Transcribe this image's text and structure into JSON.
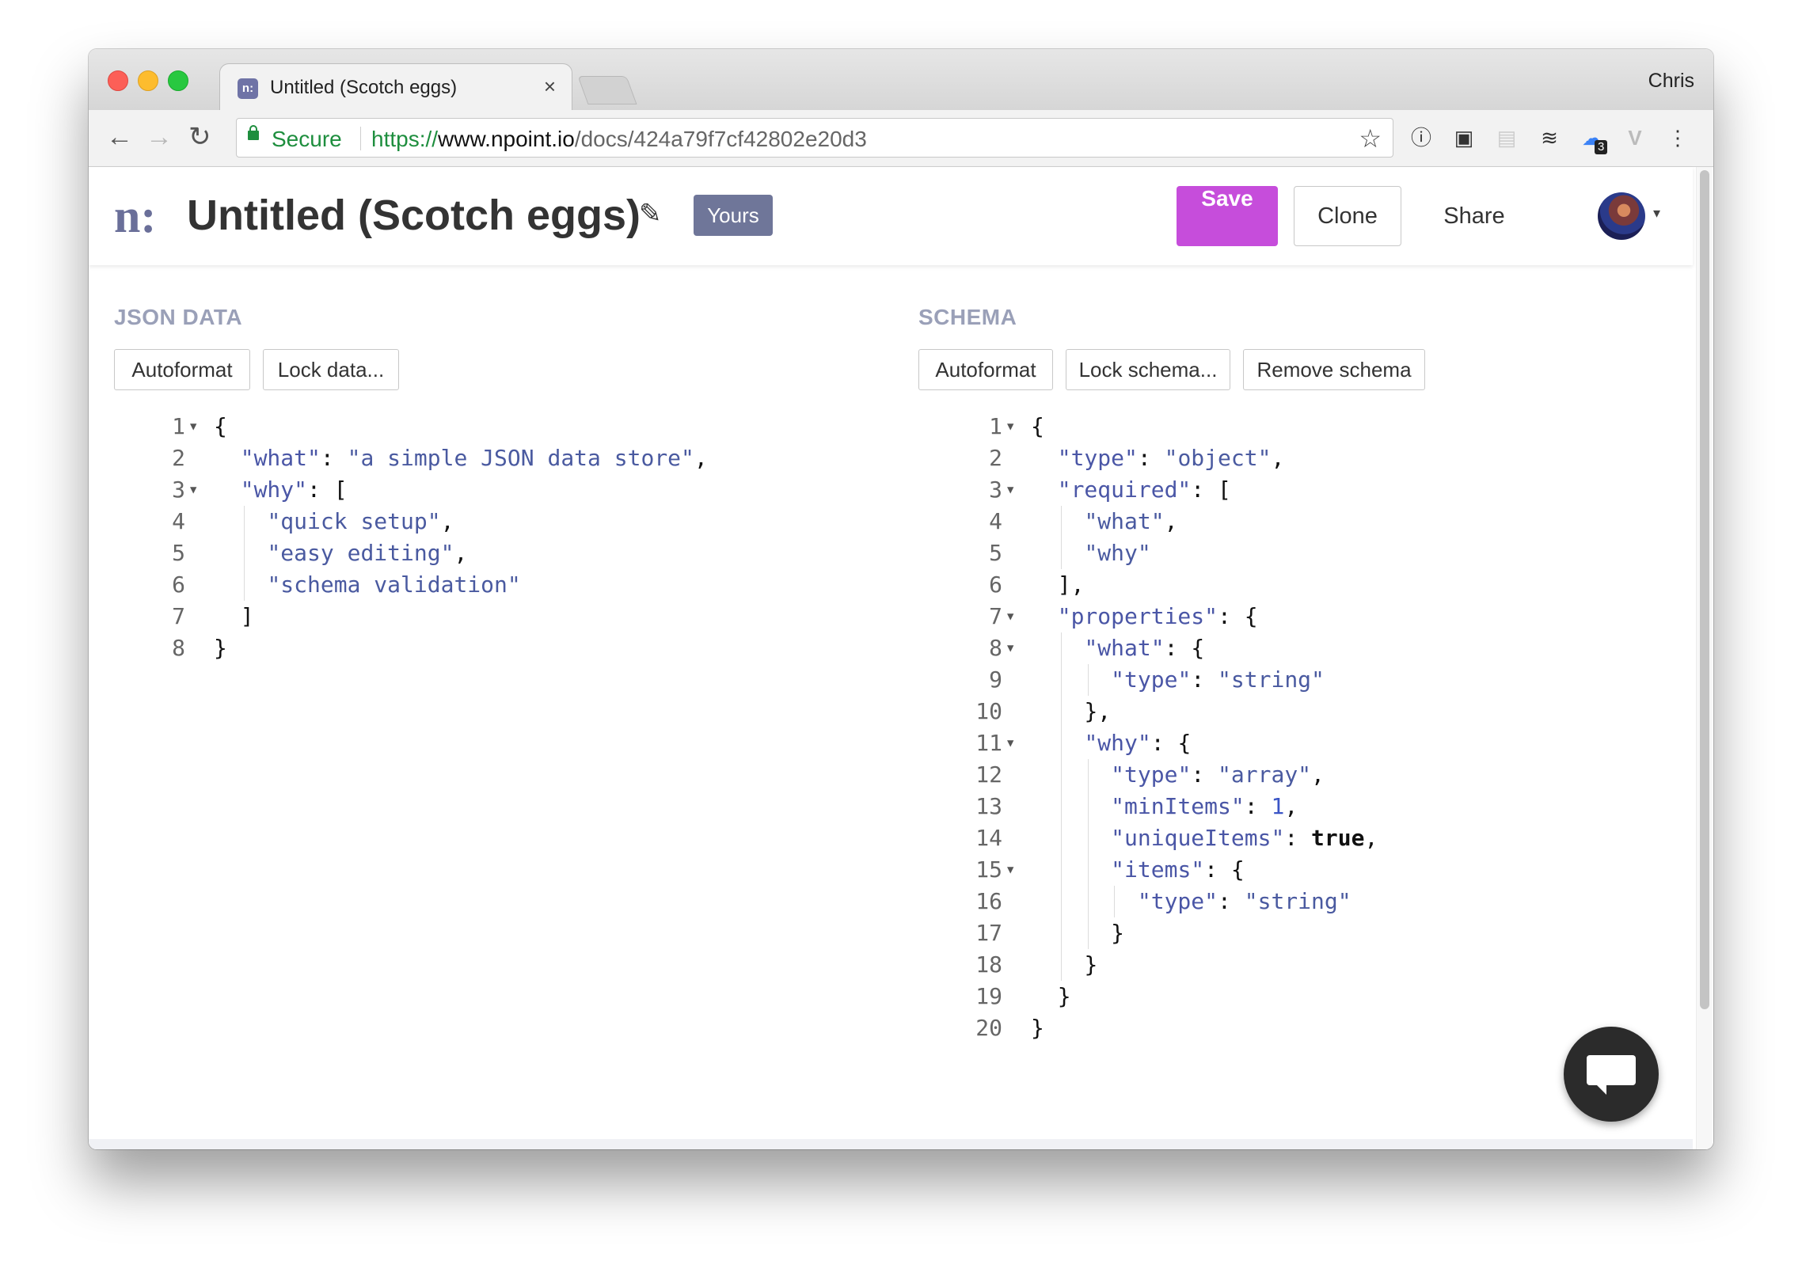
{
  "browser": {
    "tab_title": "Untitled (Scotch eggs)",
    "tab_favicon_text": "n:",
    "tab_close": "×",
    "profile_name": "Chris",
    "nav": {
      "back": "←",
      "forward": "→",
      "reload": "↻"
    },
    "omnibox": {
      "secure_label": "Secure",
      "url_scheme": "https://",
      "url_host": "www.npoint.io",
      "url_path": "/docs/424a79f7cf42802e20d3"
    },
    "star": "☆",
    "extensions": [
      {
        "name": "onepassword-icon",
        "glyph": "ⓘ"
      },
      {
        "name": "clipper-icon",
        "glyph": "▣"
      },
      {
        "name": "document-icon",
        "glyph": "▤"
      },
      {
        "name": "buffer-icon",
        "glyph": "≋"
      },
      {
        "name": "ghostery-icon",
        "glyph": "☁",
        "badge": "3"
      },
      {
        "name": "vue-devtools-icon",
        "glyph": "V"
      },
      {
        "name": "menu-kebab-icon",
        "glyph": "⋮"
      }
    ]
  },
  "app": {
    "logo": "n:",
    "title": "Untitled (Scotch eggs)",
    "edit_icon": "✎",
    "badge": "Yours",
    "save_label": "Save",
    "clone_label": "Clone",
    "share_label": "Share",
    "avatar_caret": "▾"
  },
  "json_pane": {
    "title": "JSON DATA",
    "buttons": [
      "Autoformat",
      "Lock data..."
    ],
    "lines": [
      {
        "n": "1",
        "fold": true,
        "code": "{"
      },
      {
        "n": "2",
        "code": "  \"what\": \"a simple JSON data store\","
      },
      {
        "n": "3",
        "fold": true,
        "code": "  \"why\": ["
      },
      {
        "n": "4",
        "code": "    \"quick setup\","
      },
      {
        "n": "5",
        "code": "    \"easy editing\","
      },
      {
        "n": "6",
        "code": "    \"schema validation\""
      },
      {
        "n": "7",
        "code": "  ]"
      },
      {
        "n": "8",
        "code": "}"
      }
    ]
  },
  "schema_pane": {
    "title": "SCHEMA",
    "buttons": [
      "Autoformat",
      "Lock schema...",
      "Remove schema"
    ],
    "lines": [
      {
        "n": "1",
        "fold": true,
        "code": "{"
      },
      {
        "n": "2",
        "code": "  \"type\": \"object\","
      },
      {
        "n": "3",
        "fold": true,
        "code": "  \"required\": ["
      },
      {
        "n": "4",
        "code": "    \"what\","
      },
      {
        "n": "5",
        "code": "    \"why\""
      },
      {
        "n": "6",
        "code": "  ],"
      },
      {
        "n": "7",
        "fold": true,
        "code": "  \"properties\": {"
      },
      {
        "n": "8",
        "fold": true,
        "code": "    \"what\": {"
      },
      {
        "n": "9",
        "code": "      \"type\": \"string\""
      },
      {
        "n": "10",
        "code": "    },"
      },
      {
        "n": "11",
        "fold": true,
        "code": "    \"why\": {"
      },
      {
        "n": "12",
        "code": "      \"type\": \"array\","
      },
      {
        "n": "13",
        "code": "      \"minItems\": 1,"
      },
      {
        "n": "14",
        "code": "      \"uniqueItems\": true,"
      },
      {
        "n": "15",
        "fold": true,
        "code": "      \"items\": {"
      },
      {
        "n": "16",
        "code": "        \"type\": \"string\""
      },
      {
        "n": "17",
        "code": "      }"
      },
      {
        "n": "18",
        "code": "    }"
      },
      {
        "n": "19",
        "code": "  }"
      },
      {
        "n": "20",
        "code": "}"
      }
    ]
  },
  "colors": {
    "save": "#c64ddb",
    "badge": "#6f7699",
    "section_title": "#9aa0b8",
    "key": "#4a56a6",
    "string": "#4a5aa0",
    "number": "#3b55c6",
    "secure": "#1e8e3e"
  }
}
